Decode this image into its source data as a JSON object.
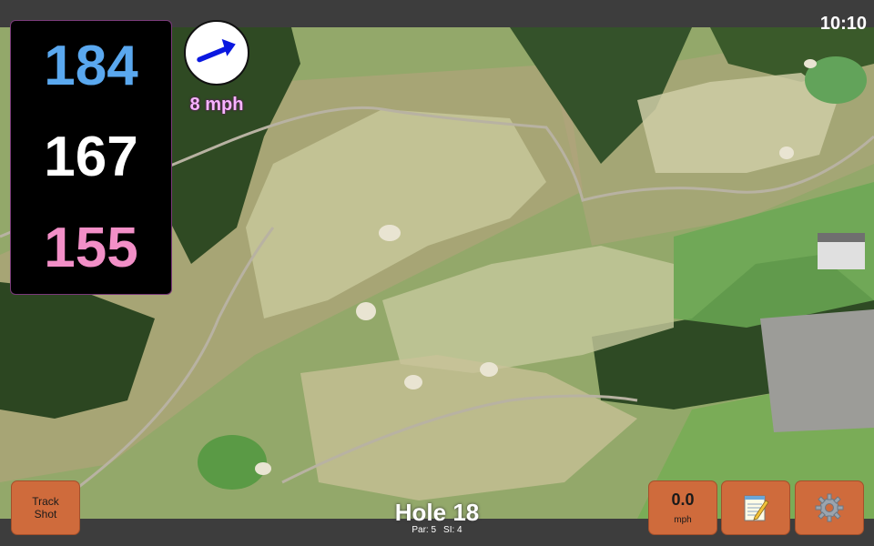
{
  "status": {
    "clock": "10:10"
  },
  "yardages": {
    "back": "184",
    "center": "167",
    "front": "155"
  },
  "wind": {
    "speed_label": "8 mph",
    "direction_icon": "wind-arrow-icon"
  },
  "buttons": {
    "track_shot_line1": "Track",
    "track_shot_line2": "Shot",
    "speed_value": "0.0",
    "speed_unit": "mph",
    "notes_icon": "notepad-icon",
    "settings_icon": "gear-icon"
  },
  "hole": {
    "title": "Hole 18",
    "par": "Par: 5",
    "si": "SI: 4"
  },
  "colors": {
    "back_yardage": "#5aa8ef",
    "center_yardage": "#ffffff",
    "front_yardage": "#f28fc7",
    "button": "#cf6b3c",
    "wind_label": "#f7b4ff"
  }
}
